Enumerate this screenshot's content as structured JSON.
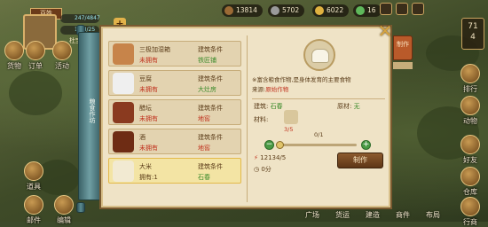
{
  "player": {
    "name_tag": "百姓",
    "exp1": "247/4847",
    "exp2": "12/3/25",
    "location": "杜宝安"
  },
  "resources": [
    {
      "icon": "wood-icon",
      "value": "13814",
      "color": "#9b6a35"
    },
    {
      "icon": "stone-icon",
      "value": "5702",
      "color": "#9a9a9a"
    },
    {
      "icon": "coin-icon",
      "value": "6022",
      "color": "#e0b240"
    },
    {
      "icon": "gem-icon",
      "value": "16",
      "color": "#5fb85b"
    }
  ],
  "timer": {
    "line1": "71",
    "line2": "4"
  },
  "side_left": [
    {
      "label": "货物",
      "icon": "goods-icon"
    },
    {
      "label": "订单",
      "icon": "order-icon"
    },
    {
      "label": "活动",
      "icon": "event-icon"
    },
    {
      "label": "道具",
      "icon": "item-icon"
    },
    {
      "label": "邮件",
      "icon": "mail-icon"
    },
    {
      "label": "编辑",
      "icon": "edit-icon"
    }
  ],
  "side_right": [
    {
      "label": "排行",
      "icon": "rank-icon"
    },
    {
      "label": "动物",
      "icon": "animal-icon"
    },
    {
      "label": "好友",
      "icon": "friend-icon"
    },
    {
      "label": "仓库",
      "icon": "storage-icon"
    },
    {
      "label": "行商",
      "icon": "merchant-icon"
    }
  ],
  "bottom_bar": [
    "广场",
    "货运",
    "建造",
    "商件",
    "布局"
  ],
  "panel": {
    "strip_label": "粮食作坊",
    "tab_label": "制作",
    "close": "✕",
    "recipes": [
      {
        "name": "三极加湿箱",
        "status": "未拥有",
        "cond_label": "建筑条件",
        "cond_value": "铁匠铺",
        "cond_ok": true,
        "color": "#c7844a"
      },
      {
        "name": "豆腐",
        "status": "未拥有",
        "cond_label": "建筑条件",
        "cond_value": "大灶房",
        "cond_ok": true,
        "color": "#efefef"
      },
      {
        "name": "醋坛",
        "status": "未拥有",
        "cond_label": "建筑条件",
        "cond_value": "地窖",
        "cond_ok": false,
        "color": "#8a3a1f"
      },
      {
        "name": "酒",
        "status": "未拥有",
        "cond_label": "建筑条件",
        "cond_value": "地窖",
        "cond_ok": false,
        "color": "#6e2c14"
      },
      {
        "name": "大米",
        "status": "拥有:1",
        "cond_label": "建筑条件",
        "cond_value": "石春",
        "cond_ok": true,
        "color": "#f2ead2",
        "selected": true
      }
    ],
    "detail": {
      "desc": "※富含粮食作物,是身体发育的主要食物",
      "source_label": "来源:",
      "source_value": "原始作物",
      "building_label": "建筑:",
      "building_value": "石春",
      "labor_label": "原材:",
      "labor_value": "无",
      "material_label": "材料:",
      "material_count": "3/5",
      "slider_value": "0/1",
      "cost_value": "12134/5",
      "time_value": "0分",
      "make_button": "制作"
    }
  }
}
